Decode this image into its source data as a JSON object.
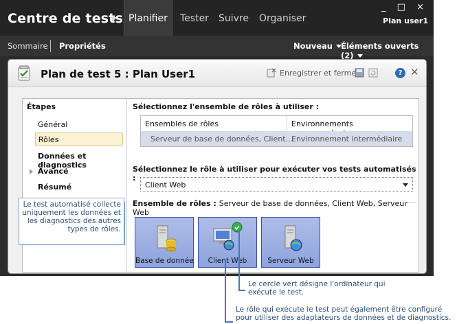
{
  "app": {
    "title": "Centre de tests",
    "nav": [
      "Planifier",
      "Tester",
      "Suivre",
      "Organiser"
    ],
    "window_controls": "_ □ ×",
    "user": "Plan user1"
  },
  "subnav": {
    "summary": "Sommaire",
    "properties": "Propriétés",
    "new": "Nouveau",
    "open_items": "Éléments ouverts (2)"
  },
  "document": {
    "title": "Plan de test 5 : Plan User1",
    "save_close": "Enregistrer et fermer",
    "help": "?",
    "close": "✕"
  },
  "steps": {
    "title": "Étapes",
    "items": [
      "Général",
      "Rôles",
      "Données et diagnostics",
      "Avancé",
      "Résumé"
    ]
  },
  "roles": {
    "select_roleset_label": "Sélectionnez l'ensemble de rôles à utiliser :",
    "columns": [
      "Ensembles de rôles",
      "Environnements correspondants"
    ],
    "row": [
      "Serveur de base de données, Client...",
      "Environnement intermédiaire"
    ],
    "select_role_label": "Sélectionnez le rôle à utiliser pour exécuter vos tests automatisés :",
    "selected_role": "Client Web",
    "roleset_title": "Ensemble de rôles :",
    "roleset_value": "Serveur de base de données, Client Web, Serveur Web",
    "tiles": [
      "Base de données...",
      "Client Web",
      "Serveur Web"
    ]
  },
  "callouts": {
    "left": "Le test automatisé collecte uniquement les données et les diagnostics des autres types de rôles.",
    "green_1": "Le cercle vert désigne l'ordinateur qui",
    "green_2": "exécute le test.",
    "role_1": "Le rôle qui exécute le test peut également être configuré",
    "role_2": "pour utiliser des adaptateurs de données et de diagnostics."
  },
  "colors": {
    "accent_tile": "#8ea3de",
    "callout": "#3d78c0",
    "selected_step": "#fbf1d3"
  }
}
